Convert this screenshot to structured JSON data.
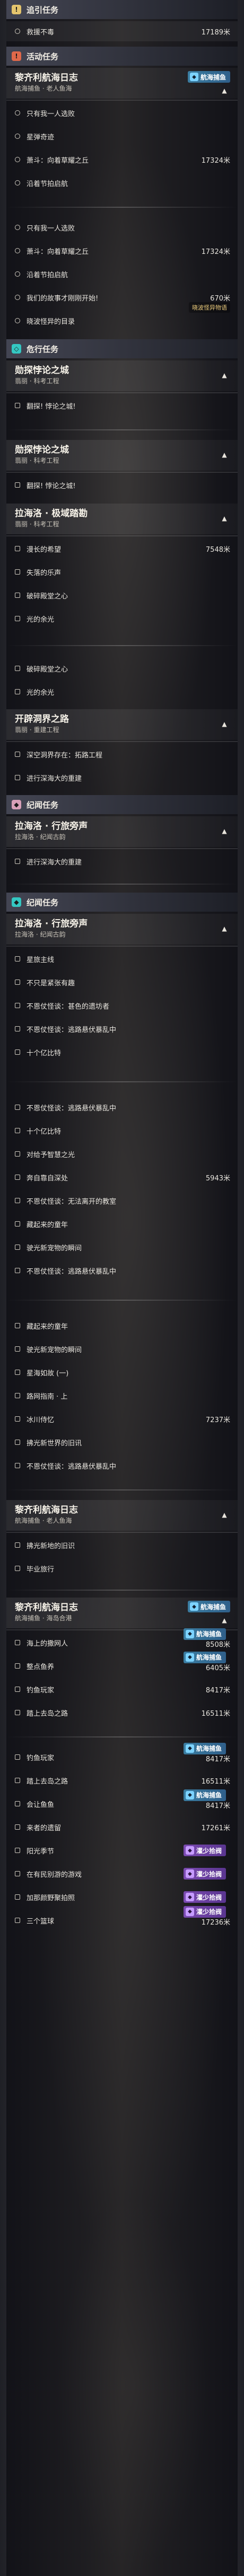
{
  "sections": {
    "guide": {
      "title": "追引任务",
      "rows": [
        {
          "label": "救援不毒",
          "dist": "17189米"
        }
      ]
    },
    "event": {
      "title": "活动任务",
      "quest1": {
        "title": "黎齐利航海日志",
        "subtitle": "航海捕鱼 · 老人鱼海",
        "badge": "航海捕鱼"
      },
      "rows1": [
        {
          "label": "只有我一人选败",
          "dist": ""
        },
        {
          "label": "星弹奇迹",
          "dist": ""
        },
        {
          "label": "萧斗：向着草耀之丘",
          "dist": "17324米"
        },
        {
          "label": "沿着节拍启航",
          "dist": ""
        }
      ],
      "rows2": [
        {
          "label": "只有我一人选败",
          "dist": ""
        },
        {
          "label": "萧斗：向着草耀之丘",
          "dist": "17324米"
        },
        {
          "label": "沿着节拍启航",
          "dist": ""
        },
        {
          "label": "我们的故事才刚刚开始!",
          "dist": "670米"
        },
        {
          "label": "晓波怪异的目录",
          "dist": ""
        }
      ],
      "watermark": "晓波怪异物语"
    },
    "danger": {
      "title": "危行任务",
      "q1": {
        "title": "勋探悖论之城",
        "subtitle": "翡丽 · 科考工程"
      },
      "q1rows": [
        {
          "label": "翻探! 悖论之城!",
          "dist": ""
        }
      ],
      "q2": {
        "title": "勋探悖论之城",
        "subtitle": "翡丽 · 科考工程"
      },
      "q2rows": [
        {
          "label": "翻探! 悖论之城!",
          "dist": ""
        }
      ],
      "q3": {
        "title": "拉海洛 · 极域踏勘",
        "subtitle": "翡丽 · 科考工程"
      },
      "q3rows": [
        {
          "label": "漫长的希望",
          "dist": "7548米"
        },
        {
          "label": "失落的乐声",
          "dist": ""
        },
        {
          "label": "破碎殿堂之心",
          "dist": ""
        },
        {
          "label": "光的余光",
          "dist": ""
        }
      ],
      "q3rows2": [
        {
          "label": "破碎殿堂之心",
          "dist": ""
        },
        {
          "label": "光的余光",
          "dist": ""
        }
      ],
      "q4": {
        "title": "开辟洞界之路",
        "subtitle": "翡丽 · 重建工程"
      },
      "q4rows": [
        {
          "label": "深空洞界存在：拓路工程",
          "dist": ""
        },
        {
          "label": "进行深海大的重建",
          "dist": ""
        }
      ]
    },
    "story1": {
      "title": "纪闻任务",
      "q": {
        "title": "拉海洛 · 行旅旁声",
        "subtitle": "拉海洛 · 纪闻古韵"
      },
      "rows": [
        {
          "label": "进行深海大的重建",
          "dist": ""
        }
      ]
    },
    "story2": {
      "title": "纪闻任务",
      "q": {
        "title": "拉海洛 · 行旅旁声",
        "subtitle": "拉海洛 · 纪闻古韵"
      },
      "rows": [
        {
          "label": "星旅主线",
          "dist": ""
        },
        {
          "label": "不只是紧张有趣",
          "dist": ""
        },
        {
          "label": "不恩仗怪谈：甚色的遗坊者",
          "dist": ""
        },
        {
          "label": "不恩仗怪谈：逃路悬伏暴乱中",
          "dist": ""
        },
        {
          "label": "十个亿比特",
          "dist": ""
        }
      ],
      "rows2": [
        {
          "label": "不恩仗怪谈：逃路悬伏暴乱中",
          "dist": ""
        },
        {
          "label": "十个亿比特",
          "dist": ""
        },
        {
          "label": "对给予智慧之光",
          "dist": ""
        },
        {
          "label": "奔自靠自深处",
          "dist": "5943米"
        },
        {
          "label": "不恩仗怪谈：无法离开的教室",
          "dist": ""
        },
        {
          "label": "藏起来的童年",
          "dist": ""
        },
        {
          "label": "驶光新宠物的瞬间",
          "dist": ""
        },
        {
          "label": "不恩仗怪谈：逃路悬伏暴乱中",
          "dist": ""
        }
      ],
      "rows3": [
        {
          "label": "藏起来的童年",
          "dist": ""
        },
        {
          "label": "驶光新宠物的瞬间",
          "dist": ""
        },
        {
          "label": "星海如故 (一)",
          "dist": ""
        },
        {
          "label": "路网指南 · 上",
          "dist": ""
        },
        {
          "label": "冰川侍忆",
          "dist": "7237米"
        },
        {
          "label": "拂光新世界的旧讯",
          "dist": ""
        },
        {
          "label": "不恩仗怪谈：逃路悬伏暴乱中",
          "dist": ""
        }
      ]
    },
    "log": {
      "q1": {
        "title": "黎齐利航海日志",
        "subtitle": "航海捕鱼 · 老人鱼海"
      },
      "q1rows": [
        {
          "label": "拂光新地的旧识",
          "dist": ""
        },
        {
          "label": "毕业旅行",
          "dist": ""
        }
      ],
      "q2": {
        "title": "黎齐利航海日志",
        "subtitle": "航海捕鱼 · 海岛合港",
        "badge": "航海捕鱼"
      },
      "q2rows": [
        {
          "label": "海上的撒网人",
          "dist": "8508米",
          "badge": "航海捕鱼"
        },
        {
          "label": "整点鱼养",
          "dist": "6405米",
          "badge": "航海捕鱼"
        },
        {
          "label": "钓鱼玩家",
          "dist": "8417米",
          "badge": ""
        },
        {
          "label": "踏上去岛之路",
          "dist": "16511米",
          "badge": ""
        }
      ],
      "q2rows2": [
        {
          "label": "钓鱼玩家",
          "dist": "8417米",
          "badge": "航海捕鱼"
        },
        {
          "label": "踏上去岛之路",
          "dist": "16511米",
          "badge": ""
        },
        {
          "label": "会让鱼鱼",
          "dist": "8417米",
          "badge": "航海捕鱼"
        },
        {
          "label": "来者的遗留",
          "dist": "17261米",
          "badge": ""
        },
        {
          "label": "阳光季节",
          "dist": "",
          "badge": "灌少拾阀"
        },
        {
          "label": "在有民别游的游戏",
          "dist": "",
          "badge": "灌少拾阀"
        },
        {
          "label": "加那颜野聚拍照",
          "dist": "",
          "badge": "灌少拾阀"
        },
        {
          "label": "三个篮球",
          "dist": "17236米",
          "badge": "灌少拾阀"
        }
      ]
    }
  },
  "colors": {
    "gold": "#e4c46d",
    "red": "#e0684a",
    "cyan": "#34c7c2",
    "rose": "#d8a0b8"
  }
}
